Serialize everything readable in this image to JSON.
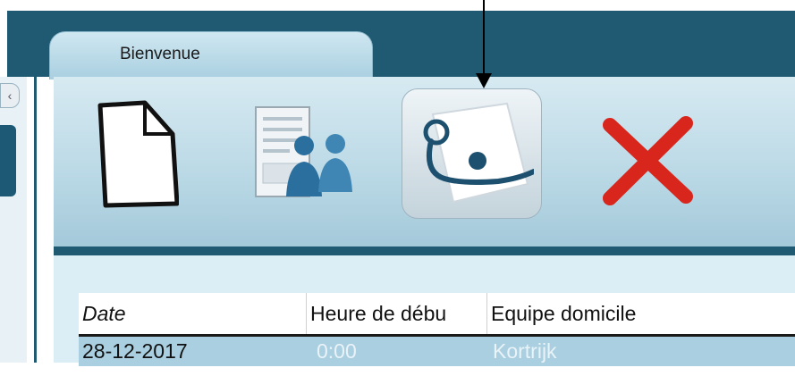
{
  "window": {
    "tab_label": "Bienvenue"
  },
  "toolbar": {
    "items": [
      {
        "name": "new-document-icon"
      },
      {
        "name": "document-users-icon"
      },
      {
        "name": "referee-whistle-icon"
      },
      {
        "name": "delete-x-icon"
      }
    ]
  },
  "table": {
    "columns": [
      "Date",
      "Heure de débu",
      "Equipe domicile"
    ],
    "rows": [
      [
        "28-12-2017",
        "0:00",
        "Kortrijk"
      ]
    ]
  },
  "colors": {
    "header_bar": "#1f5a72",
    "toolbar_bg": "#b9d8e5",
    "selected_row": "#a9cfe0",
    "delete_red": "#d9261c"
  }
}
